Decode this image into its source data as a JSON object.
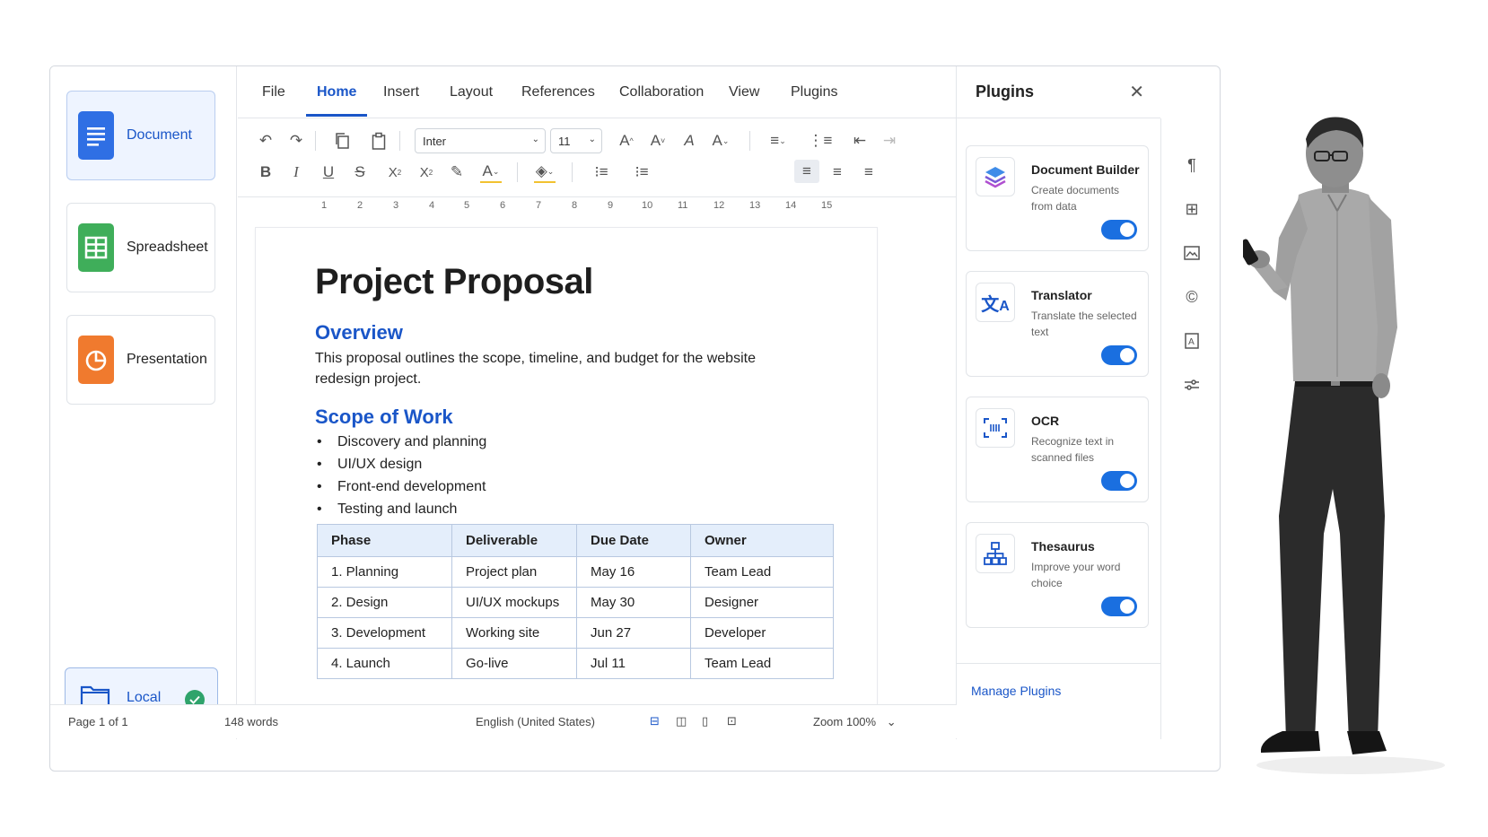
{
  "launcher": {
    "items": [
      {
        "label": "Document",
        "active": true,
        "color": "#2f6fe4"
      },
      {
        "label": "Spreadsheet",
        "active": false,
        "color": "#3fae5a"
      },
      {
        "label": "Presentation",
        "active": false,
        "color": "#f07a2e"
      }
    ],
    "storage": {
      "label": "Local",
      "status_color": "#2fa36b"
    }
  },
  "menu": {
    "items": [
      "File",
      "Home",
      "Insert",
      "Layout",
      "References",
      "Collaboration",
      "View",
      "Plugins"
    ],
    "active": "Home"
  },
  "toolbar": {
    "font_name": "Inter",
    "font_size": "11"
  },
  "ruler": [
    "1",
    "2",
    "3",
    "4",
    "5",
    "6",
    "7",
    "8",
    "9",
    "10",
    "11",
    "12",
    "13",
    "14",
    "15"
  ],
  "document": {
    "title": "Project Proposal",
    "overview_heading": "Overview",
    "overview_text": "This proposal outlines the scope, timeline, and budget for the website redesign project.",
    "scope_heading": "Scope of Work",
    "scope_items": [
      "Discovery and planning",
      "UI/UX design",
      "Front-end development",
      "Testing and launch"
    ],
    "table": {
      "headers": [
        "Phase",
        "Deliverable",
        "Due Date",
        "Owner"
      ],
      "rows": [
        [
          "1. Planning",
          "Project plan",
          "May 16",
          "Team Lead"
        ],
        [
          "2. Design",
          "UI/UX mockups",
          "May 30",
          "Designer"
        ],
        [
          "3. Development",
          "Working site",
          "Jun 27",
          "Developer"
        ],
        [
          "4. Launch",
          "Go-live",
          "Jul 11",
          "Team Lead"
        ]
      ]
    }
  },
  "status": {
    "page_label": "Page",
    "page_current": "1",
    "page_of": "of 1",
    "words": "148 words",
    "language": "English (United States)",
    "zoom": "Zoom 100%"
  },
  "plugins": {
    "title": "Plugins",
    "items": [
      {
        "name": "Document Builder",
        "desc": "Create documents from data",
        "enabled": true,
        "icon": "layers-icon"
      },
      {
        "name": "Translator",
        "desc": "Translate the selected text",
        "enabled": true,
        "icon": "translate-icon"
      },
      {
        "name": "OCR",
        "desc": "Recognize text in scanned files",
        "enabled": true,
        "icon": "ocr-scan-icon"
      },
      {
        "name": "Thesaurus",
        "desc": "Improve your word choice",
        "enabled": true,
        "icon": "hierarchy-icon"
      }
    ],
    "manage_label": "Manage Plugins"
  },
  "colors": {
    "accent": "#1a56c8",
    "toggle_on": "#1a6fe0"
  }
}
